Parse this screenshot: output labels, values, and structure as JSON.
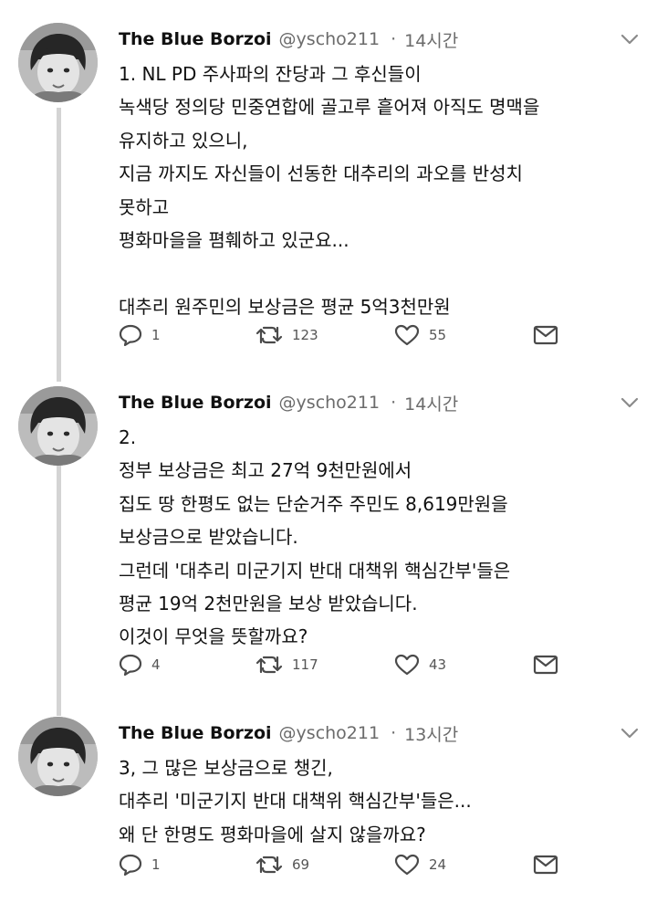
{
  "tweets": [
    {
      "name": "The Blue Borzoi",
      "handle": "@yscho211",
      "time": "14시간",
      "lines": [
        "1. NL PD 주사파의 잔당과 그 후신들이",
        "녹색당 정의당 민중연합에 골고루 흩어져 아직도 명맥을",
        "유지하고 있으니,",
        "지금 까지도 자신들이 선동한 대추리의 과오를 반성치",
        "못하고",
        "평화마을을 폄훼하고 있군요...",
        "",
        "대추리 원주민의 보상금은 평균 5억3천만원"
      ],
      "replies": "1",
      "retweets": "123",
      "likes": "55"
    },
    {
      "name": "The Blue Borzoi",
      "handle": "@yscho211",
      "time": "14시간",
      "lines": [
        "2.",
        "정부 보상금은 최고 27억 9천만원에서",
        "집도 땅 한평도 없는 단순거주 주민도 8,619만원을",
        "보상금으로 받았습니다.",
        "그런데 '대추리 미군기지 반대 대책위 핵심간부'들은",
        "평균 19억 2천만원을 보상 받았습니다.",
        "이것이 무엇을 뜻할까요?"
      ],
      "replies": "4",
      "retweets": "117",
      "likes": "43"
    },
    {
      "name": "The Blue Borzoi",
      "handle": "@yscho211",
      "time": "13시간",
      "lines": [
        "3, 그 많은 보상금으로 챙긴,",
        "대추리 '미군기지 반대 대책위 핵심간부'들은...",
        "왜 단 한명도 평화마을에 살지 않을까요?"
      ],
      "replies": "1",
      "retweets": "69",
      "likes": "24"
    }
  ],
  "icons": {
    "reply": "reply-icon",
    "retweet": "retweet-icon",
    "like": "like-icon",
    "dm": "direct-message-icon",
    "caret": "chevron-down-icon",
    "avatar": "avatar"
  },
  "colors": {
    "text": "#111111",
    "muted": "#6b6b6b",
    "icon": "#4a4a4a",
    "thread_line": "#d4d4d4"
  }
}
